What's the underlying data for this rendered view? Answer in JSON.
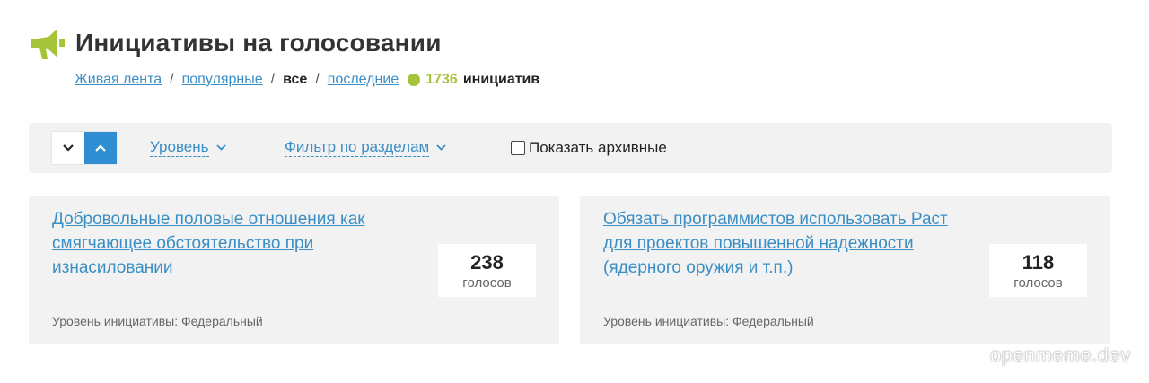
{
  "header": {
    "title": "Инициативы на голосовании",
    "icon": "megaphone-icon"
  },
  "nav": {
    "items": [
      {
        "label": "Живая лента"
      },
      {
        "label": "популярные"
      },
      {
        "label": "все"
      },
      {
        "label": "последние"
      }
    ],
    "separator": "/",
    "count": "1736",
    "count_label": "инициатив"
  },
  "toolbar": {
    "level_label": "Уровень",
    "filter_label": "Фильтр по разделам",
    "archive_label": "Показать архивные",
    "archive_checked": false
  },
  "cards": [
    {
      "title": "Добровольные половые отношения как смягчающее обстоятельство при изнасиловании",
      "votes": "238",
      "votes_label": "голосов",
      "level": "Уровень инициативы: Федеральный"
    },
    {
      "title": "Обязать программистов использовать Раст для проектов повышенной надежности (ядерного оружия и т.п.)",
      "votes": "118",
      "votes_label": "голосов",
      "level": "Уровень инициативы: Федеральный"
    }
  ],
  "watermark": "openmeme.dev",
  "colors": {
    "accent_blue": "#3a8ec4",
    "button_blue": "#2f8ed1",
    "accent_green": "#a6c43a",
    "panel_bg": "#f2f2f2"
  }
}
